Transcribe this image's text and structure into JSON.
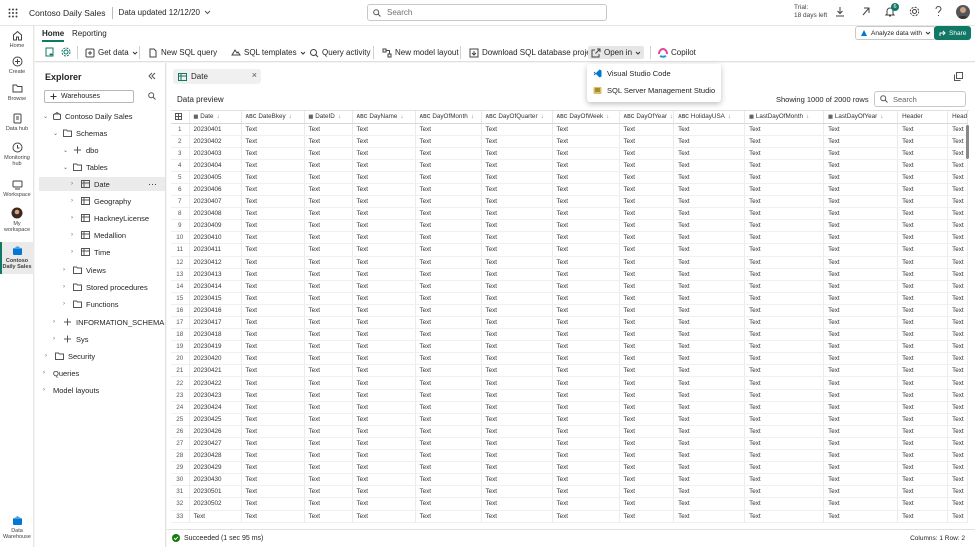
{
  "topbar": {
    "workspace": "Contoso Daily Sales",
    "updated": "Data updated 12/12/20",
    "search_placeholder": "Search",
    "trial_line1": "Trial:",
    "trial_line2": "18 days left",
    "notif_count": "6"
  },
  "leftnav": {
    "items": [
      {
        "label": "Home",
        "icon": "home-icon"
      },
      {
        "label": "Create",
        "icon": "create-icon"
      },
      {
        "label": "Browse",
        "icon": "browse-icon"
      },
      {
        "label": "Data hub",
        "icon": "datahub-icon"
      },
      {
        "label": "Monitoring hub",
        "icon": "monitoring-icon"
      },
      {
        "label": "Workspace",
        "icon": "workspace-icon"
      },
      {
        "label": "My workspace",
        "icon": "my-workspace-icon"
      },
      {
        "label": "Contoso Daily Sales",
        "icon": "warehouse-icon"
      },
      {
        "label": "Data Warehouse",
        "icon": "data-warehouse-icon"
      }
    ]
  },
  "tabs": {
    "home": "Home",
    "reporting": "Reporting"
  },
  "ribbon": {
    "get_data": "Get data",
    "new_sql": "New SQL query",
    "sql_templates": "SQL templates",
    "query_activity": "Query activity",
    "new_model_layout": "New model layout",
    "download_project": "Download SQL database project",
    "open_in": "Open in",
    "copilot": "Copilot",
    "analyze": "Analyze data with",
    "share": "Share"
  },
  "dropdown": {
    "vscode": "Visual Studio Code",
    "ssms": "SQL Server Management Studio"
  },
  "explorer": {
    "title": "Explorer",
    "warehouses": "Warehouses",
    "tree": {
      "db": "Contoso Daily Sales",
      "schemas": "Schemas",
      "dbo": "dbo",
      "tables": "Tables",
      "t_date": "Date",
      "t_geo": "Geography",
      "t_hackney": "HackneyLicense",
      "t_medallion": "Medallion",
      "t_time": "Time",
      "views": "Views",
      "sprocs": "Stored procedures",
      "functions": "Functions",
      "infoschema": "INFORMATION_SCHEMA",
      "sys": "Sys",
      "security": "Security",
      "queries": "Queries",
      "model_layouts": "Model layouts"
    }
  },
  "tab": {
    "title": "Date"
  },
  "preview": {
    "label": "Data preview",
    "row_info": "Showing 1000 of 2000 rows",
    "search_placeholder": "Search"
  },
  "grid": {
    "columns": [
      {
        "name": "Date",
        "type": "date"
      },
      {
        "name": "DateBkey",
        "type": "ABC"
      },
      {
        "name": "DateID",
        "type": "date"
      },
      {
        "name": "DayName",
        "type": "ABC"
      },
      {
        "name": "DayOfMonth",
        "type": "ABC"
      },
      {
        "name": "DayOfQuarter",
        "type": "ABC"
      },
      {
        "name": "DayOfWeek",
        "type": "ABC"
      },
      {
        "name": "DayOfYear",
        "type": "ABC"
      },
      {
        "name": "HolidayUSA",
        "type": "ABC"
      },
      {
        "name": "LastDayOfMonth",
        "type": "date"
      },
      {
        "name": "LastDayOfYear",
        "type": "date"
      },
      {
        "name": "Header",
        "type": ""
      },
      {
        "name": "Head",
        "type": ""
      }
    ],
    "cell_text": "Text",
    "rows": [
      {
        "n": "1",
        "date": "20230401"
      },
      {
        "n": "2",
        "date": "20230402"
      },
      {
        "n": "3",
        "date": "20230403"
      },
      {
        "n": "4",
        "date": "20230404"
      },
      {
        "n": "5",
        "date": "20230405"
      },
      {
        "n": "6",
        "date": "20230406"
      },
      {
        "n": "7",
        "date": "20230407"
      },
      {
        "n": "8",
        "date": "20230408"
      },
      {
        "n": "9",
        "date": "20230409"
      },
      {
        "n": "10",
        "date": "20230410"
      },
      {
        "n": "11",
        "date": "20230411"
      },
      {
        "n": "12",
        "date": "20230412"
      },
      {
        "n": "13",
        "date": "20230413"
      },
      {
        "n": "14",
        "date": "20230414"
      },
      {
        "n": "15",
        "date": "20230415"
      },
      {
        "n": "16",
        "date": "20230416"
      },
      {
        "n": "17",
        "date": "20230417"
      },
      {
        "n": "18",
        "date": "20230418"
      },
      {
        "n": "19",
        "date": "20230419"
      },
      {
        "n": "20",
        "date": "20230420"
      },
      {
        "n": "21",
        "date": "20230421"
      },
      {
        "n": "22",
        "date": "20230422"
      },
      {
        "n": "23",
        "date": "20230423"
      },
      {
        "n": "24",
        "date": "20230424"
      },
      {
        "n": "25",
        "date": "20230425"
      },
      {
        "n": "26",
        "date": "20230426"
      },
      {
        "n": "27",
        "date": "20230427"
      },
      {
        "n": "28",
        "date": "20230428"
      },
      {
        "n": "29",
        "date": "20230429"
      },
      {
        "n": "30",
        "date": "20230430"
      },
      {
        "n": "31",
        "date": "20230501"
      },
      {
        "n": "32",
        "date": "20230502"
      },
      {
        "n": "33",
        "date": "Text"
      }
    ]
  },
  "status": {
    "message": "Succeeded (1 sec 95 ms)",
    "col_info": "Columns: 1 Row: 2"
  },
  "colors": {
    "accent": "#117865",
    "success": "#107c10",
    "vscode": "#0078d4"
  }
}
